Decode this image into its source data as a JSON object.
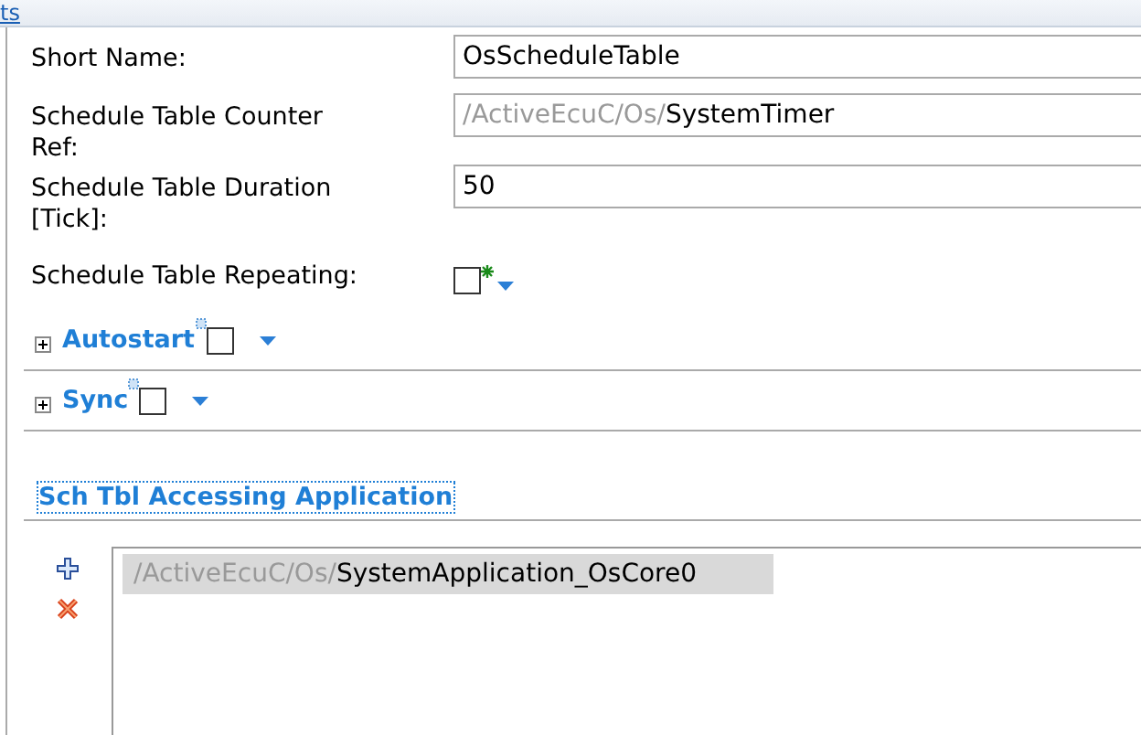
{
  "top_link": "ts",
  "fields": [
    {
      "kind": "text",
      "label": "Short Name:",
      "value": "OsScheduleTable"
    },
    {
      "kind": "reference",
      "label": "Schedule Table Counter Ref:",
      "prefix": "/ActiveEcuC/Os/",
      "value": "SystemTimer"
    },
    {
      "kind": "text",
      "label": "Schedule Table Duration [Tick]:",
      "value": "50"
    },
    {
      "kind": "checkbox",
      "label": "Schedule Table Repeating:",
      "checked": false
    }
  ],
  "sections": [
    {
      "title": "Autostart",
      "expanded": false,
      "checked": false
    },
    {
      "title": "Sync",
      "expanded": false,
      "checked": false
    }
  ],
  "accessing": {
    "title": "Sch Tbl Accessing Application",
    "items": [
      {
        "prefix": "/ActiveEcuC/Os/",
        "value": "SystemApplication_OsCore0",
        "selected": true
      }
    ]
  }
}
